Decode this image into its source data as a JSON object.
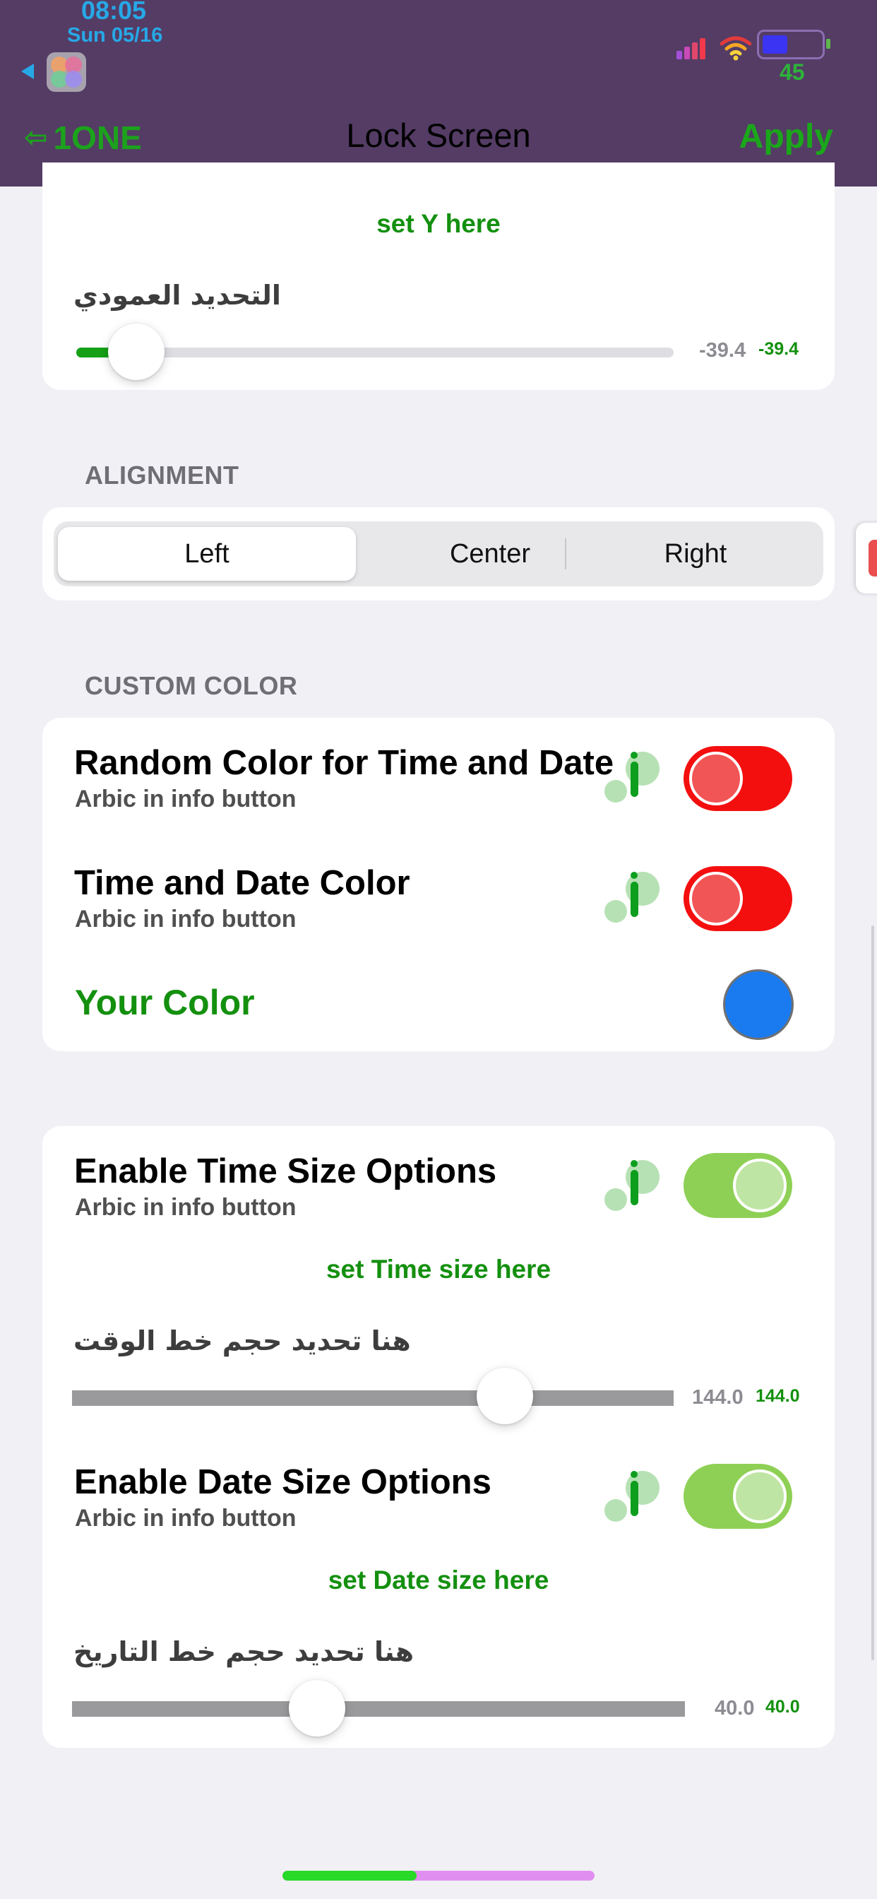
{
  "status_bar": {
    "time": "08:05",
    "date": "Sun 05/16",
    "battery_percent": "45",
    "battery_fill_fraction": 0.42
  },
  "nav": {
    "back_label": "1ONE",
    "title": "Lock Screen",
    "apply_label": "Apply"
  },
  "vertical_section": {
    "green_hint": "set Y here",
    "arabic_label": "التحديد العمودي",
    "slider_fraction": 0.1,
    "value_grey": "-39.4",
    "value_green": "-39.4"
  },
  "alignment": {
    "header": "ALIGNMENT",
    "segments": [
      "Left",
      "Center",
      "Right"
    ],
    "selected": "Left"
  },
  "custom_color": {
    "header": "CUSTOM COLOR",
    "random_title": "Random Color for Time and Date",
    "random_sub": "Arbic in info button",
    "random_on": false,
    "color_title": "Time and Date Color",
    "color_sub": "Arbic in info button",
    "color_on": false,
    "your_color_label": "Your Color",
    "your_color_value": "#1a7bf1"
  },
  "size_options": {
    "time_title": "Enable Time Size Options",
    "time_sub": "Arbic in info button",
    "time_on": true,
    "time_hint": "set Time size here",
    "time_arabic": "هنا تحديد حجم خط الوقت",
    "time_slider_fraction": 0.72,
    "time_value_grey": "144.0",
    "time_value_green": "144.0",
    "date_title": "Enable Date Size Options",
    "date_sub": "Arbic in info button",
    "date_on": true,
    "date_hint": "set Date size here",
    "date_arabic": "هنا تحديد حجم خط التاريخ",
    "date_slider_fraction": 0.4,
    "date_value_grey": "40.0",
    "date_value_green": "40.0"
  },
  "colors": {
    "header_bg": "#543c65",
    "accent_green": "#14900f",
    "toggle_off_red": "#f40f0f",
    "toggle_on_green": "#8ed055"
  }
}
